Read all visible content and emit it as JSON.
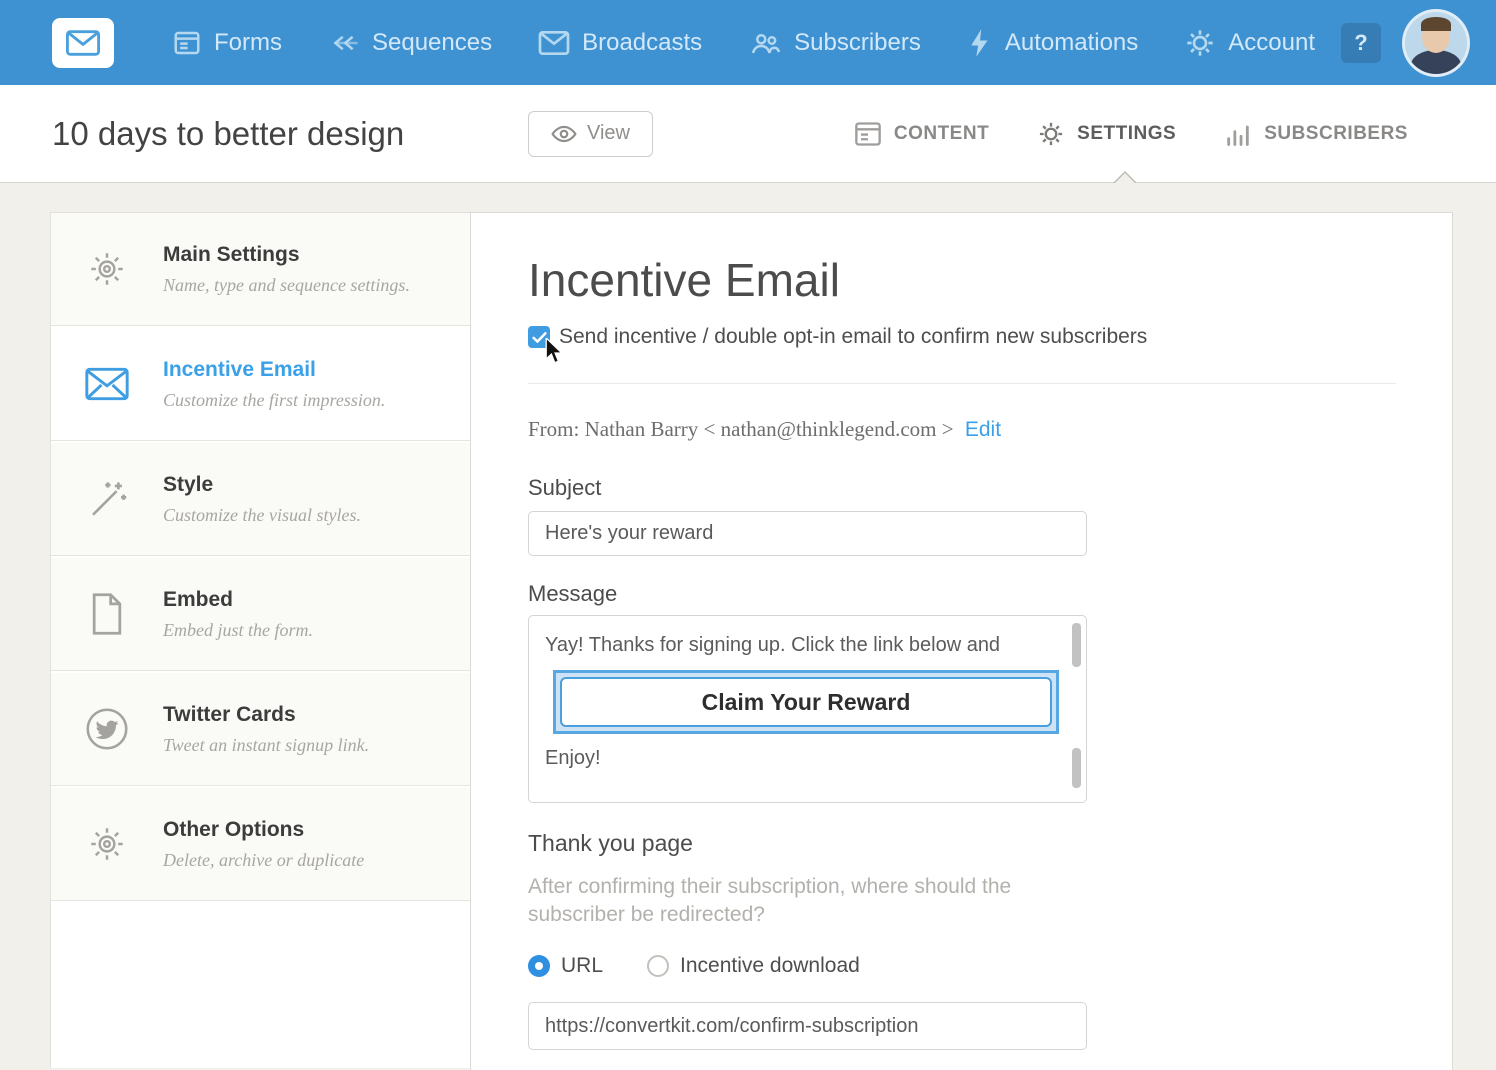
{
  "colors": {
    "nav_blue": "#3e92d2",
    "accent_blue": "#3aa0e8",
    "page_bg": "#f2f0eb"
  },
  "nav": {
    "items": [
      {
        "label": "Forms"
      },
      {
        "label": "Sequences"
      },
      {
        "label": "Broadcasts"
      },
      {
        "label": "Subscribers"
      },
      {
        "label": "Automations"
      },
      {
        "label": "Account"
      }
    ],
    "help_label": "?"
  },
  "header": {
    "title": "10 days to better design",
    "view_button": "View",
    "tabs": [
      {
        "label": "CONTENT"
      },
      {
        "label": "SETTINGS",
        "active": true
      },
      {
        "label": "SUBSCRIBERS"
      }
    ]
  },
  "sidebar": {
    "items": [
      {
        "title": "Main Settings",
        "desc": "Name, type and sequence settings.",
        "icon": "gear-icon"
      },
      {
        "title": "Incentive Email",
        "desc": "Customize the first impression.",
        "icon": "envelope-icon",
        "active": true
      },
      {
        "title": "Style",
        "desc": "Customize the visual styles.",
        "icon": "wand-icon"
      },
      {
        "title": "Embed",
        "desc": "Embed just the form.",
        "icon": "document-icon"
      },
      {
        "title": "Twitter Cards",
        "desc": "Tweet an instant signup link.",
        "icon": "twitter-icon"
      },
      {
        "title": "Other Options",
        "desc": "Delete, archive or duplicate",
        "icon": "gear-icon"
      }
    ]
  },
  "main": {
    "title": "Incentive Email",
    "checkbox_label": "Send incentive / double opt-in email to confirm new subscribers",
    "checkbox_checked": true,
    "from_text": "From: Nathan Barry < nathan@thinklegend.com >",
    "edit_link": "Edit",
    "subject_label": "Subject",
    "subject_value": "Here's your reward",
    "message_label": "Message",
    "message_line1": "Yay! Thanks for signing up. Click the link below and",
    "message_button": "Claim Your Reward",
    "message_line2": "Enjoy!",
    "thankyou_label": "Thank you page",
    "thankyou_desc": "After confirming their subscription, where should the subscriber be redirected?",
    "radio_options": [
      {
        "label": "URL",
        "selected": true
      },
      {
        "label": "Incentive download",
        "selected": false
      }
    ],
    "url_value": "https://convertkit.com/confirm-subscription"
  }
}
